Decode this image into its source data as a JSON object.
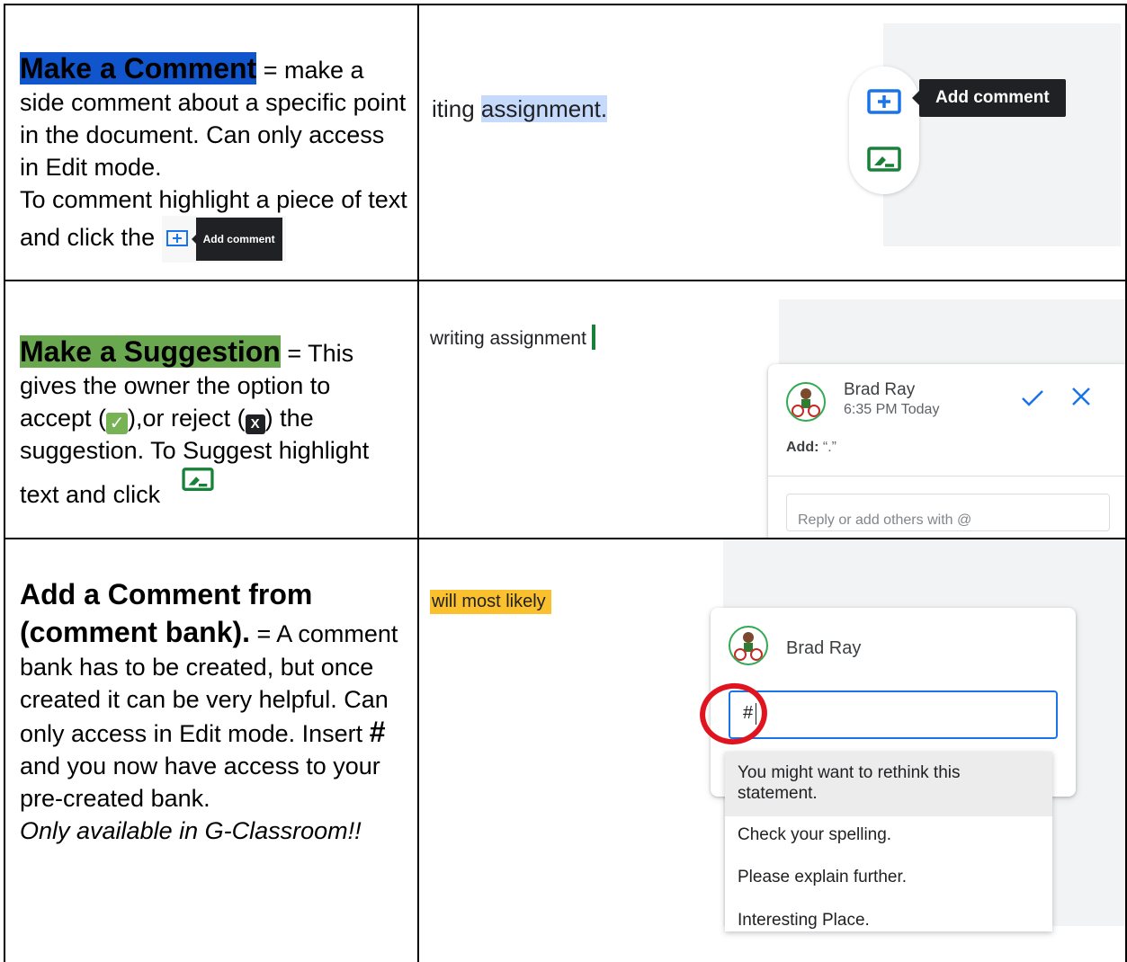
{
  "row1": {
    "heading": "Make a Comment",
    "desc": " = make a side comment about a specific point in the document. Can only access in Edit mode.",
    "instruction": "To comment highlight a piece of text and click the",
    "mini_tooltip": "Add comment",
    "doc_text_plain": "iting ",
    "doc_text_highlight": "assignment.",
    "tooltip": "Add comment"
  },
  "row2": {
    "heading": "Make a Suggestion",
    "desc_a": " = This gives the owner the option to accept (",
    "desc_b": "),or reject (",
    "desc_c": ") the suggestion. To Suggest highlight text and click",
    "doc_text": "writing assignment",
    "card_user": "Brad Ray",
    "card_time": "6:35 PM Today",
    "card_add_label": "Add:",
    "card_add_value": "“.”",
    "reply_placeholder": "Reply or add others with @"
  },
  "row3": {
    "heading": "Add a Comment from (comment bank).",
    "desc_a": " = A comment bank has to be created, but once created it can be very helpful.  Can only access in Edit mode. Insert ",
    "hash": "#",
    "desc_b": " and you now have access to your pre-created bank.",
    "note": "Only available in G-Classroom!!",
    "doc_text": "will most likely",
    "card_user": "Brad Ray",
    "input_value": "#",
    "suggestions": [
      "You might want to rethink this statement.",
      "Check your spelling.",
      "Please explain further.",
      "Interesting Place."
    ]
  },
  "colors": {
    "blue_highlight": "#1155cc",
    "green_highlight": "#6aa84f",
    "yellow_highlight": "#fbc02d",
    "selection": "#c6dafc",
    "google_blue": "#1a73e8",
    "google_green": "#188038",
    "red_circle": "#e0141e"
  }
}
